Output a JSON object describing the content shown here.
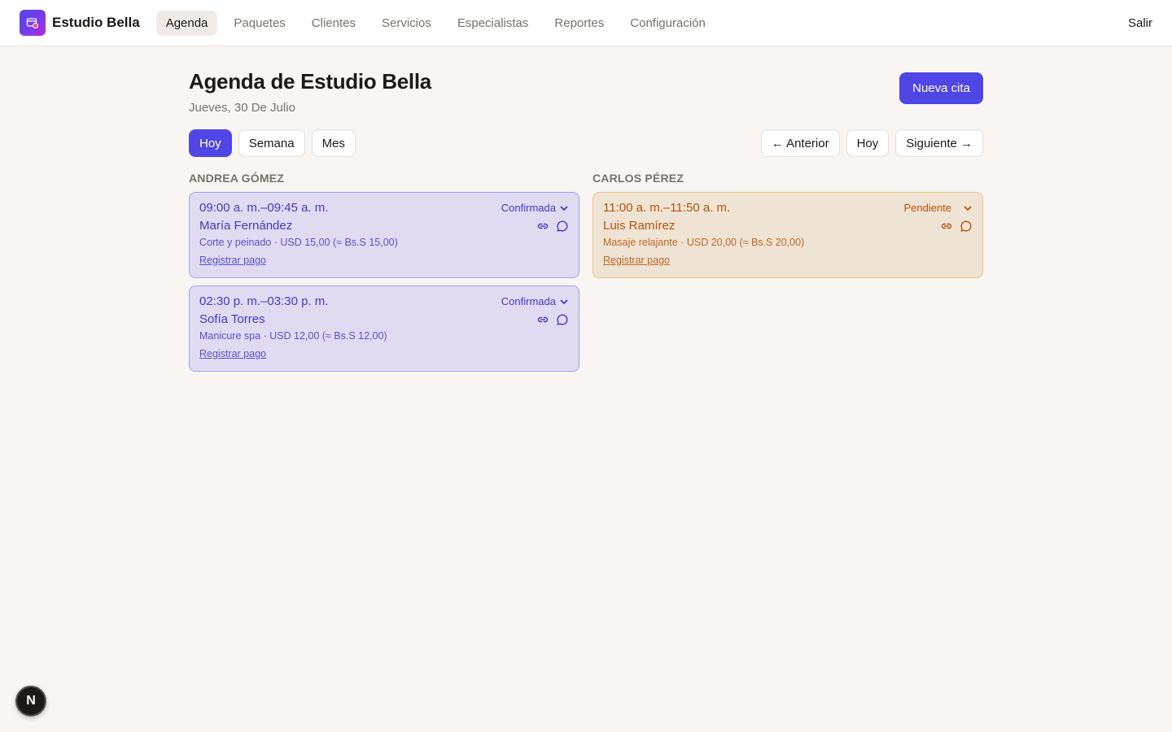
{
  "app": {
    "brand_name": "Estudio Bella",
    "nav": [
      {
        "label": "Agenda",
        "active": true
      },
      {
        "label": "Paquetes",
        "active": false
      },
      {
        "label": "Clientes",
        "active": false
      },
      {
        "label": "Servicios",
        "active": false
      },
      {
        "label": "Especialistas",
        "active": false
      },
      {
        "label": "Reportes",
        "active": false
      },
      {
        "label": "Configuración",
        "active": false
      }
    ],
    "logout_label": "Salir"
  },
  "page": {
    "title": "Agenda de Estudio Bella",
    "date": "Jueves, 30 De Julio",
    "new_button": "Nueva cita"
  },
  "view_tabs": [
    {
      "label": "Hoy",
      "active": true
    },
    {
      "label": "Semana",
      "active": false
    },
    {
      "label": "Mes",
      "active": false
    }
  ],
  "pager": {
    "prev": "← Anterior",
    "today": "Hoy",
    "next": "Siguiente →"
  },
  "columns": [
    {
      "specialist": "ANDREA GÓMEZ",
      "appointments": [
        {
          "time": "09:00 a. m.–09:45 a. m.",
          "status": "Confirmada",
          "client": "María Fernández",
          "service": "Corte y peinado · USD 15,00 (≈ Bs.S 15,00)",
          "pay_label": "Registrar pago",
          "kind": "confirmed"
        },
        {
          "time": "02:30 p. m.–03:30 p. m.",
          "status": "Confirmada",
          "client": "Sofía Torres",
          "service": "Manicure spa · USD 12,00 (≈ Bs.S 12,00)",
          "pay_label": "Registrar pago",
          "kind": "confirmed"
        }
      ]
    },
    {
      "specialist": "CARLOS PÉREZ",
      "appointments": [
        {
          "time": "11:00 a. m.–11:50 a. m.",
          "status": "Pendiente",
          "client": "Luis Ramírez",
          "service": "Masaje relajante · USD 20,00 (≈ Bs.S 20,00)",
          "pay_label": "Registrar pago",
          "kind": "pending"
        }
      ]
    }
  ],
  "fab_label": "N",
  "colors": {
    "accent": "#4f46e5",
    "confirmed_bg": "#e0dbf1",
    "pending_bg": "#efe3d3",
    "pending_text": "#b45309"
  },
  "icons": {
    "brand": "calendar-icon",
    "link": "link-icon",
    "message": "message-icon",
    "status_dropdown": "chevron-down-icon"
  }
}
